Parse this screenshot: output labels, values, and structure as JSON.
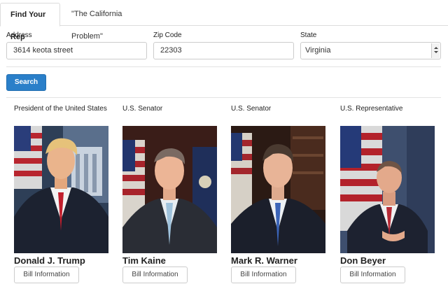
{
  "tabs": [
    {
      "label": "Find Your Rep",
      "active": true
    },
    {
      "label": "\"The California Problem\"",
      "active": false
    }
  ],
  "form": {
    "address_label": "Address",
    "address_value": "3614 keota street",
    "zip_label": "Zip Code",
    "zip_value": "22303",
    "state_label": "State",
    "state_value": "Virginia",
    "search_label": "Search"
  },
  "reps": [
    {
      "office": "President of the United States",
      "name": "Donald J. Trump",
      "button": "Bill Information"
    },
    {
      "office": "U.S. Senator",
      "name": "Tim Kaine",
      "button": "Bill Information"
    },
    {
      "office": "U.S. Senator",
      "name": "Mark R. Warner",
      "button": "Bill Information"
    },
    {
      "office": "U.S. Representative",
      "name": "Don Beyer",
      "button": "Bill Information"
    }
  ],
  "colors": {
    "primary_button": "#2a7fc9",
    "border": "#cccccc"
  }
}
